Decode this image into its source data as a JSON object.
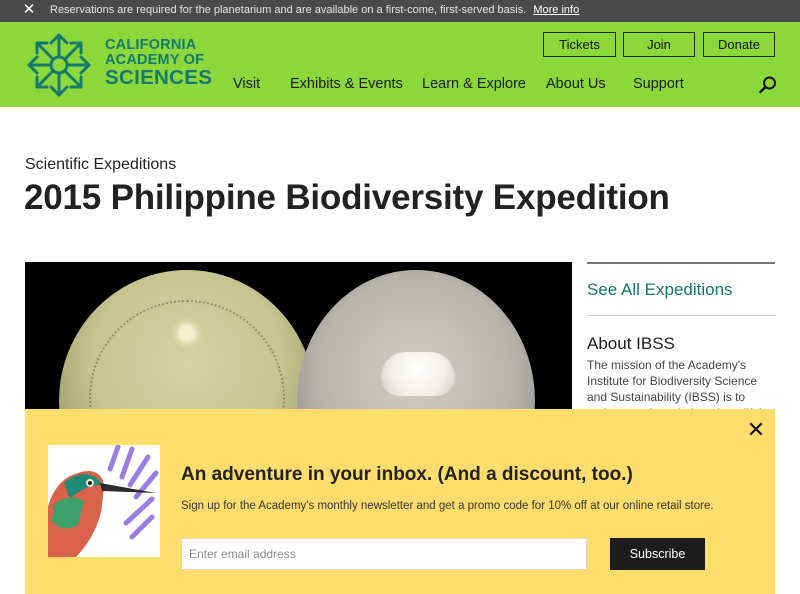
{
  "alert": {
    "message": "Reservations are required for the planetarium and are available on a first-come, first-served basis.",
    "link_label": "More info"
  },
  "logo": {
    "line1": "CALIFORNIA",
    "line2": "ACADEMY OF",
    "line3": "SCIENCES"
  },
  "utility_nav": {
    "tickets": "Tickets",
    "join": "Join",
    "donate": "Donate"
  },
  "main_nav": {
    "items": [
      "Visit",
      "Exhibits & Events",
      "Learn & Explore",
      "About Us",
      "Support"
    ]
  },
  "page": {
    "kicker": "Scientific Expeditions",
    "title": "2015 Philippine Biodiversity Expedition"
  },
  "sidebar": {
    "see_all": "See All Expeditions",
    "about_title": "About IBSS",
    "about_body": "The mission of the Academy's Institute for Biodiversity Science and Sustainability (IBSS) is to gather new knowledge about life's"
  },
  "newsletter_modal": {
    "headline": "An adventure in your inbox. (And a discount, too.)",
    "subtext": "Sign up for the Academy's monthly newsletter and get a promo code for 10% off at our online retail store.",
    "email_placeholder": "Enter email address",
    "subscribe_label": "Subscribe"
  },
  "colors": {
    "header_green": "#8cd83b",
    "brand_teal": "#157a6e",
    "alert_bg": "#4a4a4a",
    "modal_yellow": "#fedd6c",
    "link_teal": "#167566"
  },
  "icons": {
    "alert_close": "close-icon",
    "logo": "starburst-logo-icon",
    "search": "search-icon",
    "modal_close": "close-icon"
  }
}
